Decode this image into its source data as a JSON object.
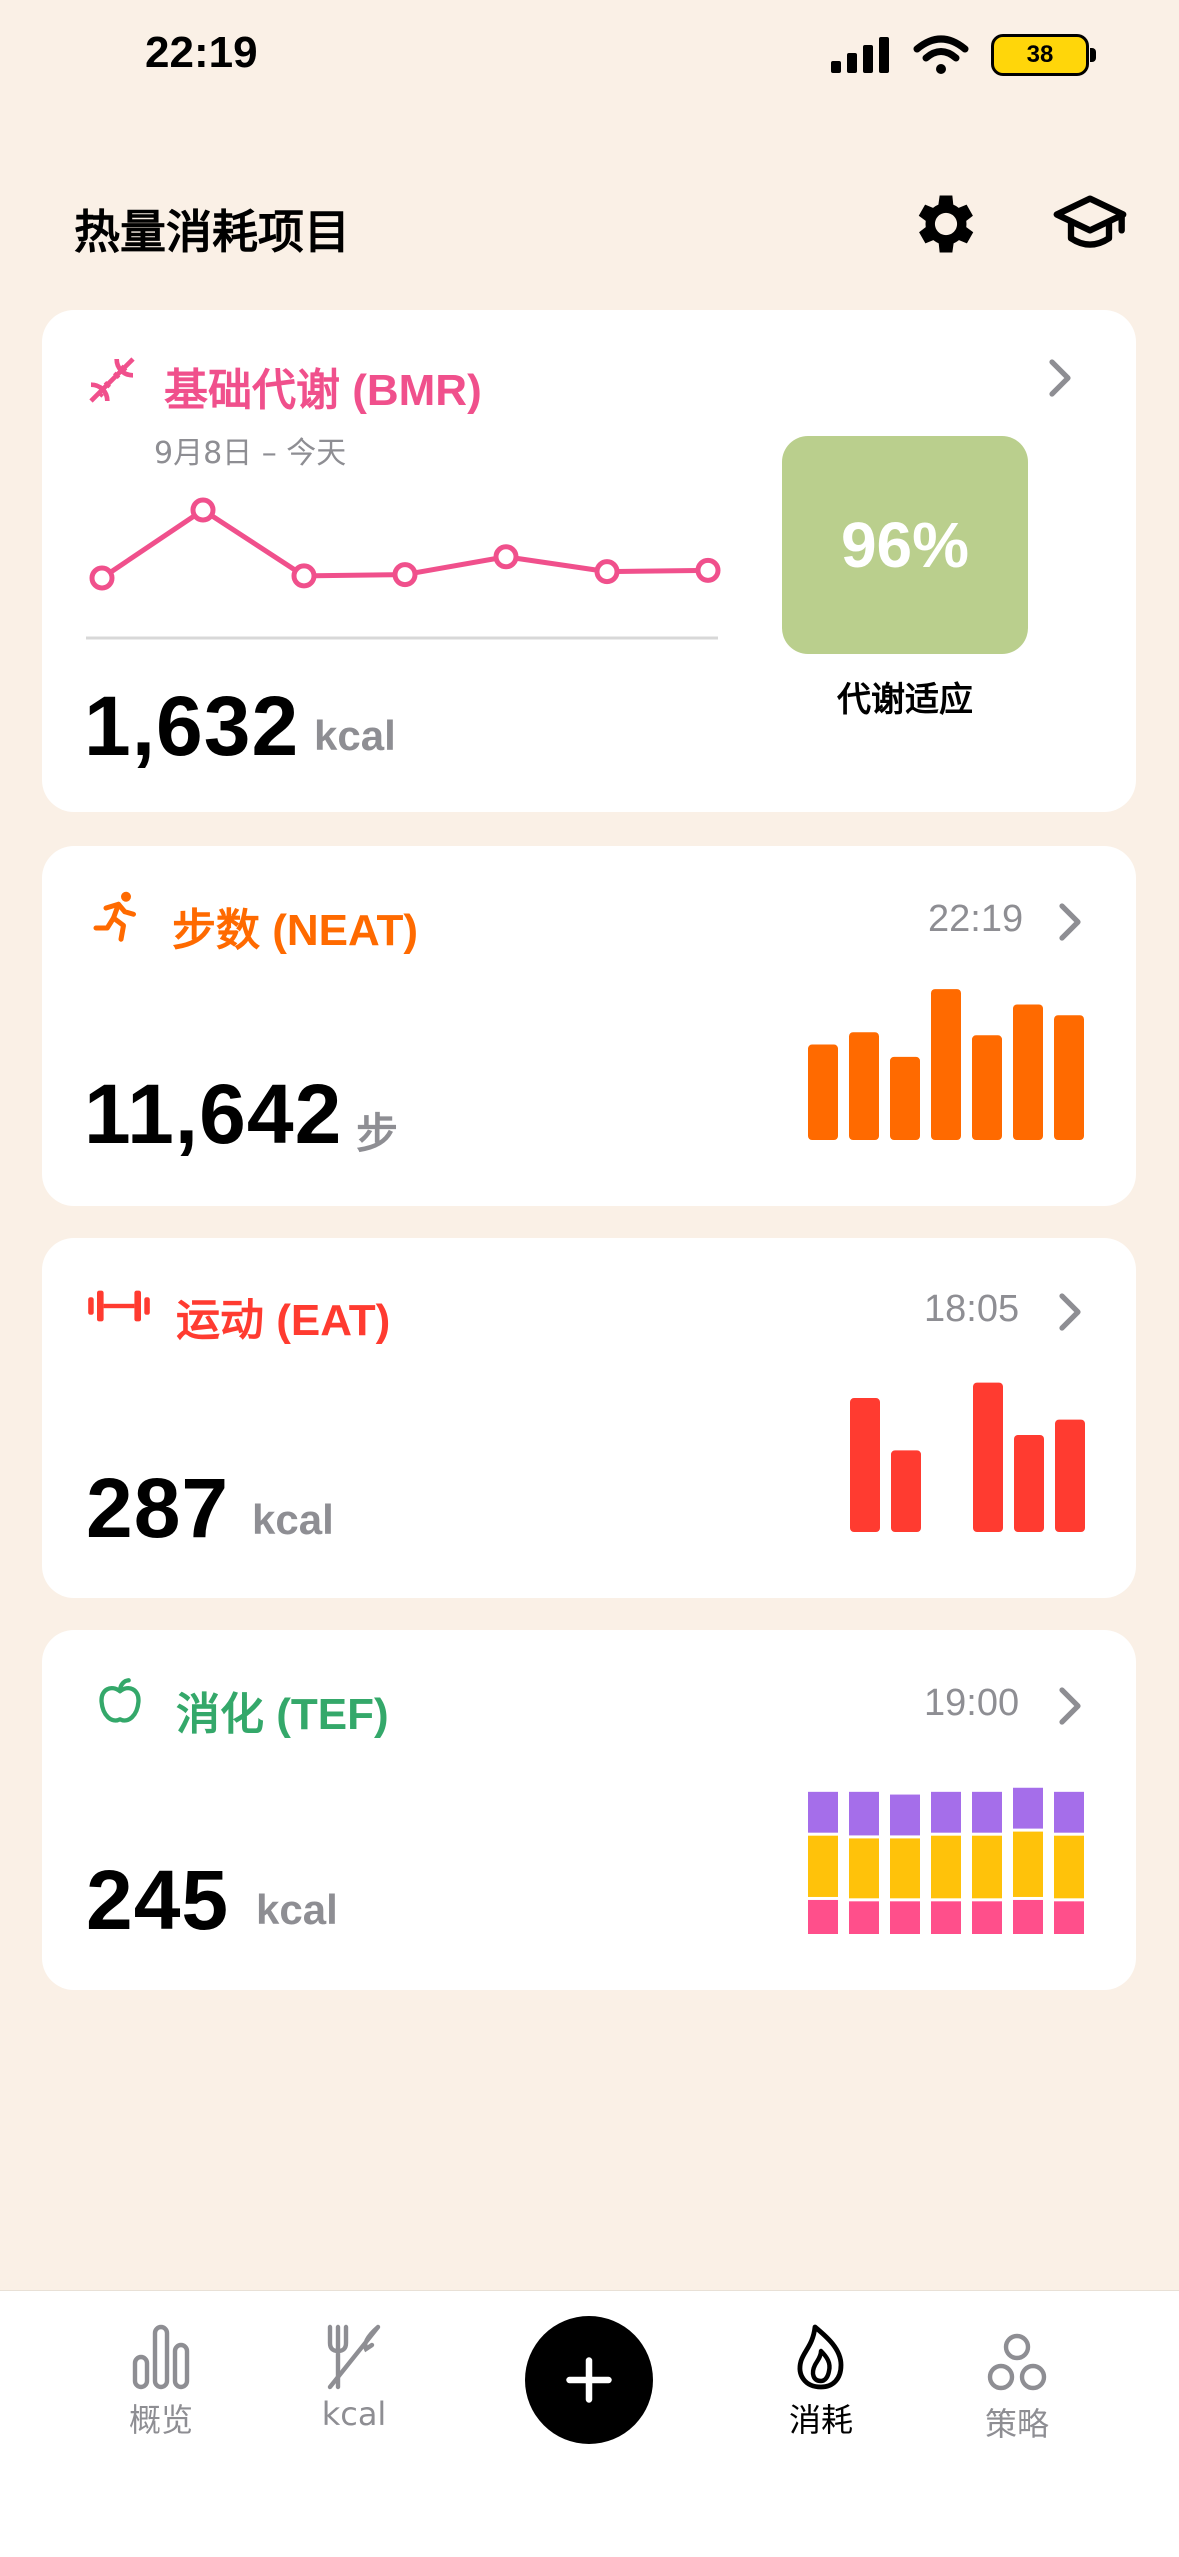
{
  "status_bar": {
    "time": "22:19",
    "battery": "38"
  },
  "header": {
    "title": "热量消耗项目",
    "settings_icon": "gear-icon",
    "learn_icon": "graduation-cap-icon"
  },
  "bmr": {
    "title": "基础代谢 (BMR)",
    "date_range": "9月8日 – 今天",
    "value": "1,632",
    "unit": "kcal",
    "adaptation_value": "96%",
    "adaptation_label": "代谢适应",
    "accent": "#f0508c",
    "trend": [
      1560,
      1720,
      1565,
      1568,
      1610,
      1575,
      1578
    ]
  },
  "neat": {
    "title": "步数 (NEAT)",
    "time": "22:19",
    "value": "11,642",
    "unit": "步",
    "accent": "#ff6a00",
    "bars": [
      0.62,
      0.7,
      0.54,
      0.98,
      0.68,
      0.88,
      0.81
    ]
  },
  "eat": {
    "title": "运动 (EAT)",
    "time": "18:05",
    "value": "287",
    "unit": "kcal",
    "accent": "#ff3b30",
    "bars": [
      0.87,
      0.53,
      0,
      0.97,
      0.63,
      0.73
    ]
  },
  "tef": {
    "title": "消化 (TEF)",
    "time": "19:00",
    "value": "245",
    "unit": "kcal",
    "accent": "#34a86a",
    "stack_colors": [
      "#ff4f8b",
      "#ffc20a",
      "#a56eea"
    ],
    "stacks": [
      [
        0.25,
        0.45,
        0.3
      ],
      [
        0.24,
        0.44,
        0.32
      ],
      [
        0.24,
        0.44,
        0.3
      ],
      [
        0.24,
        0.46,
        0.3
      ],
      [
        0.24,
        0.46,
        0.3
      ],
      [
        0.25,
        0.48,
        0.3
      ],
      [
        0.24,
        0.46,
        0.3
      ]
    ]
  },
  "tabbar": {
    "items": [
      {
        "label": "概览",
        "icon": "bar-chart-icon"
      },
      {
        "label": "kcal",
        "icon": "fork-knife-icon"
      },
      {
        "label": "",
        "icon": "plus-icon"
      },
      {
        "label": "消耗",
        "icon": "flame-icon"
      },
      {
        "label": "策略",
        "icon": "strategy-icon"
      }
    ]
  }
}
